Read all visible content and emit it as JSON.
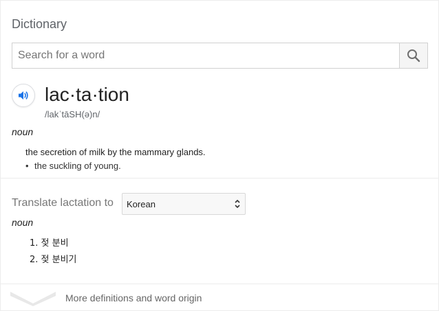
{
  "header": {
    "title": "Dictionary"
  },
  "search": {
    "placeholder": "Search for a word",
    "value": ""
  },
  "entry": {
    "word": "lac·ta·tion",
    "phonetic": "/lakˈtāSH(ə)n/",
    "part_of_speech": "noun",
    "definition": "the secretion of milk by the mammary glands.",
    "sub_definition": "the suckling of young."
  },
  "translate": {
    "label": "Translate lactation to",
    "selected_language": "Korean",
    "part_of_speech": "noun",
    "items": [
      "1. 젖 분비",
      "2. 젖 분비기"
    ]
  },
  "footer": {
    "more_label": "More definitions and word origin"
  },
  "icons": {
    "search": "search-icon",
    "speaker": "speaker-icon",
    "select": "select-arrows-icon",
    "expand": "chevron-down-icon"
  },
  "colors": {
    "accent": "#1a73e8",
    "muted": "#777777"
  }
}
